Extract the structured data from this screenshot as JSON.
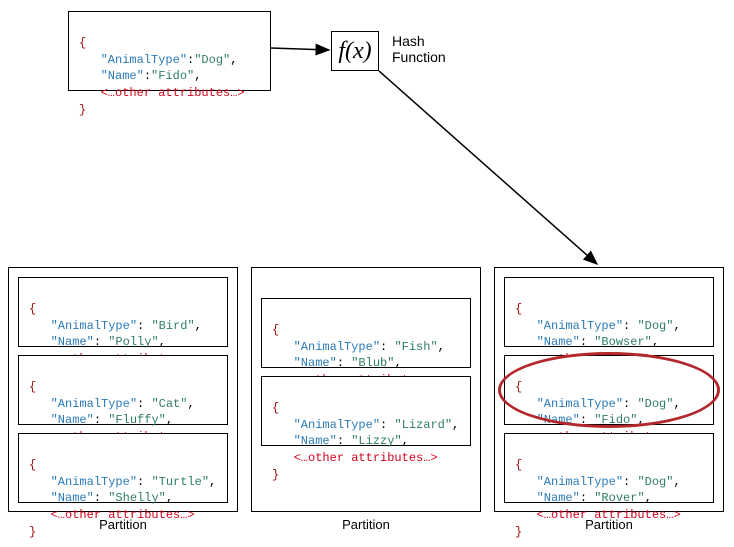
{
  "hash": {
    "fx": "f(x)",
    "label": "Hash\nFunction"
  },
  "json_display": {
    "keys": {
      "animal_type": "\"AnimalType\"",
      "name": "\"Name\""
    },
    "other_line": "<…other attributes…>",
    "brace_open": "{",
    "brace_close": "}",
    "colon": ":",
    "colon_sp": ": ",
    "comma": ","
  },
  "input_record": {
    "animal_type": "\"Dog\"",
    "name": "\"Fido\""
  },
  "partitions": {
    "label": "Partition",
    "p1": {
      "records": [
        {
          "animal_type": "\"Bird\"",
          "name": "\"Polly\""
        },
        {
          "animal_type": "\"Cat\"",
          "name": "\"Fluffy\""
        },
        {
          "animal_type": "\"Turtle\"",
          "name": "\"Shelly\""
        }
      ]
    },
    "p2": {
      "records": [
        {
          "animal_type": "\"Fish\"",
          "name": "\"Blub\""
        },
        {
          "animal_type": "\"Lizard\"",
          "name": "\"Lizzy\""
        }
      ]
    },
    "p3": {
      "records": [
        {
          "animal_type": "\"Dog\"",
          "name": "\"Bowser\""
        },
        {
          "animal_type": "\"Dog\"",
          "name": "\"Fido\""
        },
        {
          "animal_type": "\"Dog\"",
          "name": "\"Rover\""
        }
      ]
    }
  }
}
